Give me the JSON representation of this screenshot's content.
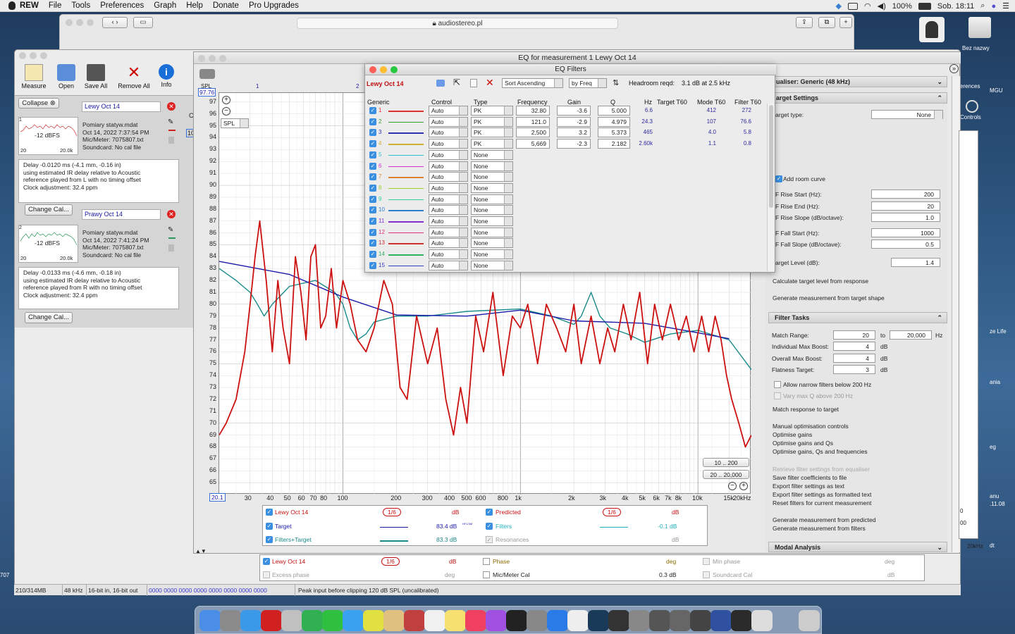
{
  "menubar": {
    "app": "REW",
    "items": [
      "File",
      "Tools",
      "Preferences",
      "Graph",
      "Help",
      "Donate",
      "Pro Upgrades"
    ],
    "battery": "100%",
    "clock": "Sob. 18:11"
  },
  "browser": {
    "url": "audiostereo.pl"
  },
  "desktop": {
    "labels": [
      "Bez nazwy",
      "erences",
      "MGU",
      "Controls",
      "ze Life",
      "ania",
      "eg",
      "anu",
      ".11.08",
      "dt",
      "707"
    ]
  },
  "toolbar": {
    "measure": "Measure",
    "open": "Open",
    "save_all": "Save All",
    "remove_all": "Remove All",
    "info": "Info"
  },
  "left": {
    "collapse": "Collapse",
    "m1": {
      "name": "Lewy Oct 14",
      "thumb_dbfs": "-12 dBFS",
      "thumb_min": "20",
      "thumb_max": "20.0k",
      "file": "Pomiary statyw.mdat",
      "date": "Oct 14, 2022 7:37:54 PM",
      "mic": "Mic/Meter: 7075807.txt",
      "sound": "Soundcard: No cal file",
      "delay1": "Delay -0.0120 ms (-4.1 mm, -0.16 in)",
      "delay2": "using estimated IR delay relative to Acoustic",
      "delay3": "reference played from  L with no timing offset",
      "delay4": "Clock adjustment: 32.4 ppm",
      "num": "1"
    },
    "m2": {
      "name": "Prawy Oct 14",
      "thumb_dbfs": "-12 dBFS",
      "thumb_min": "20",
      "thumb_max": "20.0k",
      "file": "Pomiary statyw.mdat",
      "date": "Oct 14, 2022 7:41:24 PM",
      "mic": "Mic/Meter: 7075807.txt",
      "sound": "Soundcard: No cal file",
      "delay1": "Delay -0.0133 ms (-4.6 mm, -0.18 in)",
      "delay2": "using estimated IR delay relative to Acoustic",
      "delay3": "reference played from  R with no timing offset",
      "delay4": "Clock adjustment: 32.4 ppm",
      "num": "2"
    },
    "change_cal": "Change Cal..."
  },
  "graph": {
    "window_title": "EQ for measurement 1 Lewy Oct 14",
    "y_unit": "SPL",
    "y_top": "97.76",
    "y_select": "SPL",
    "x_start": "20.1",
    "y_ticks": [
      "97",
      "96",
      "95",
      "94",
      "93",
      "92",
      "91",
      "90",
      "89",
      "88",
      "87",
      "86",
      "85",
      "84",
      "83",
      "82",
      "81",
      "80",
      "79",
      "78",
      "77",
      "76",
      "75",
      "74",
      "73",
      "72",
      "71",
      "70",
      "69",
      "68",
      "67",
      "66",
      "65"
    ],
    "x_ticks": [
      "30",
      "40",
      "50",
      "60",
      "70",
      "80",
      "100",
      "200",
      "300",
      "400",
      "500",
      "600",
      "800",
      "1k",
      "2k",
      "3k",
      "4k",
      "5k",
      "6k",
      "7k",
      "8k",
      "10k",
      "15k",
      "20kHz"
    ],
    "top_ticks": [
      "1",
      "2"
    ],
    "range1": "10 .. 200",
    "range2": "20 .. 20,000",
    "side_c": "C",
    "side_10": "10"
  },
  "legend": {
    "rows": [
      {
        "label": "Lewy Oct 14",
        "smooth": "1/6",
        "unit": "dB",
        "value": "",
        "color": "#cc1010"
      },
      {
        "label": "Target",
        "smooth": "",
        "unit": "",
        "value": "83.4 dB",
        "color": "#1a1aa8"
      },
      {
        "label": "Filters+Target",
        "smooth": "",
        "unit": "",
        "value": "83.3 dB",
        "color": "#1a8a8a"
      }
    ],
    "rows2": [
      {
        "label": "Predicted",
        "smooth": "1/6",
        "unit": "dB",
        "value": "",
        "color": "#cc1010"
      },
      {
        "label": "Filters",
        "smooth": "",
        "unit": "",
        "value": "-0.1 dB",
        "color": "#20b0c0"
      },
      {
        "label": "Resonances",
        "smooth": "",
        "unit": "dB",
        "value": "",
        "color": "#999"
      }
    ],
    "value_superscript": "HF1/3M"
  },
  "legend_bottom": {
    "name": "Lewy Oct 14",
    "smooth": "1/6",
    "db": "dB",
    "phase": "Phase",
    "deg": "deg",
    "min_phase": "Min phase",
    "deg2": "deg",
    "excess": "Excess phase",
    "deg3": "deg",
    "mic_cal": "Mic/Meter Cal",
    "mic_val": "0.3 dB",
    "sound_cal": "Soundcard Cal",
    "db2": "dB"
  },
  "eqf": {
    "title": "EQ Filters",
    "meas": "Lewy Oct 14",
    "sort": "Sort Ascending",
    "by": "by Freq",
    "headroom_label": "Headroom reqd:",
    "headroom_value": "3.1 dB at 2.5 kHz",
    "headers": {
      "generic": "Generic",
      "control": "Control",
      "type": "Type",
      "freq": "Frequency",
      "gain": "Gain",
      "q": "Q",
      "hz": "Hz",
      "target": "Target T60",
      "mode": "Mode T60",
      "filter": "Filter T60"
    },
    "rows": [
      {
        "n": "1",
        "color": "#e03030",
        "control": "Auto",
        "type": "PK",
        "freq": "32.80",
        "gain": "-3.6",
        "q": "5.000",
        "hz": "6.6",
        "mode": "412",
        "filt": "272"
      },
      {
        "n": "2",
        "color": "#30a030",
        "control": "Auto",
        "type": "PK",
        "freq": "121.0",
        "gain": "-2.9",
        "q": "4.979",
        "hz": "24.3",
        "mode": "107",
        "filt": "76.6"
      },
      {
        "n": "3",
        "color": "#3030b0",
        "control": "Auto",
        "type": "PK",
        "freq": "2,500",
        "gain": "3.2",
        "q": "5.373",
        "hz": "465",
        "mode": "4.0",
        "filt": "5.8"
      },
      {
        "n": "4",
        "color": "#d0b030",
        "control": "Auto",
        "type": "PK",
        "freq": "5,669",
        "gain": "-2.3",
        "q": "2.182",
        "hz": "2.60k",
        "mode": "1.1",
        "filt": "0.8"
      },
      {
        "n": "5",
        "color": "#30c0d0",
        "control": "Auto",
        "type": "None",
        "freq": "",
        "gain": "",
        "q": "",
        "hz": "",
        "mode": "",
        "filt": ""
      },
      {
        "n": "6",
        "color": "#d030d0",
        "control": "Auto",
        "type": "None",
        "freq": "",
        "gain": "",
        "q": "",
        "hz": "",
        "mode": "",
        "filt": ""
      },
      {
        "n": "7",
        "color": "#e08030",
        "control": "Auto",
        "type": "None",
        "freq": "",
        "gain": "",
        "q": "",
        "hz": "",
        "mode": "",
        "filt": ""
      },
      {
        "n": "8",
        "color": "#a0d030",
        "control": "Auto",
        "type": "None",
        "freq": "",
        "gain": "",
        "q": "",
        "hz": "",
        "mode": "",
        "filt": ""
      },
      {
        "n": "9",
        "color": "#30d0a0",
        "control": "Auto",
        "type": "None",
        "freq": "",
        "gain": "",
        "q": "",
        "hz": "",
        "mode": "",
        "filt": ""
      },
      {
        "n": "10",
        "color": "#3080d0",
        "control": "Auto",
        "type": "None",
        "freq": "",
        "gain": "",
        "q": "",
        "hz": "",
        "mode": "",
        "filt": ""
      },
      {
        "n": "11",
        "color": "#8030d0",
        "control": "Auto",
        "type": "None",
        "freq": "",
        "gain": "",
        "q": "",
        "hz": "",
        "mode": "",
        "filt": ""
      },
      {
        "n": "12",
        "color": "#e03080",
        "control": "Auto",
        "type": "None",
        "freq": "",
        "gain": "",
        "q": "",
        "hz": "",
        "mode": "",
        "filt": ""
      },
      {
        "n": "13",
        "color": "#d03030",
        "control": "Auto",
        "type": "None",
        "freq": "",
        "gain": "",
        "q": "",
        "hz": "",
        "mode": "",
        "filt": ""
      },
      {
        "n": "14",
        "color": "#30b060",
        "control": "Auto",
        "type": "None",
        "freq": "",
        "gain": "",
        "q": "",
        "hz": "",
        "mode": "",
        "filt": ""
      },
      {
        "n": "15",
        "color": "#3040c0",
        "control": "Auto",
        "type": "None",
        "freq": "",
        "gain": "",
        "q": "",
        "hz": "",
        "mode": "",
        "filt": ""
      }
    ]
  },
  "rightpanel": {
    "equaliser": "ualiser: Generic (48 kHz)",
    "target_settings": "arget Settings",
    "target_type": "arget type:",
    "target_type_val": "None",
    "add_room": "Add room curve",
    "rise_start": "F Rise Start (Hz):",
    "rise_start_v": "200",
    "rise_end": "F Rise End (Hz):",
    "rise_end_v": "20",
    "rise_slope": "F Rise Slope (dB/octave):",
    "rise_slope_v": "1.0",
    "fall_start": "F Fall Start (Hz):",
    "fall_start_v": "1000",
    "fall_slope": "F Fall Slope (dB/octave):",
    "fall_slope_v": "0.5",
    "target_level": "arget Level (dB):",
    "target_level_v": "1.4",
    "calc": "Calculate target level from response",
    "gen": "Generate measurement from target shape",
    "filter_tasks": "Filter Tasks",
    "match_range": "Match Range:",
    "mr1": "20",
    "to": "to",
    "mr2": "20,000",
    "hz": "Hz",
    "ind_boost": "Individual Max Boost:",
    "ind_v": "4",
    "db1": "dB",
    "ovr_boost": "Overall Max Boost:",
    "ovr_v": "4",
    "db2": "dB",
    "flat": "Flatness Target:",
    "flat_v": "3",
    "db3": "dB",
    "narrow": "Allow narrow filters below 200 Hz",
    "vary": "Vary max Q above 200 Hz",
    "match": "Match response to target",
    "manual": "Manual optimisation controls",
    "opt1": "Optimise gains",
    "opt2": "Optimise gains and Qs",
    "opt3": "Optimise gains, Qs and frequencies",
    "retrieve": "Retrieve filter settings from equaliser",
    "save": "Save filter coefficients to file",
    "export_text": "Export filter settings as text",
    "export_fmt": "Export filter settings as formatted text",
    "reset": "Reset filters for current measurement",
    "gen_pred": "Generate measurement from predicted",
    "gen_filt": "Generate measurement from filters",
    "modal": "Modal Analysis",
    "side_0": "0",
    "side_00": "00",
    "side_20k": "20kHz"
  },
  "status": {
    "mem": "210/314MB",
    "rate": "48 kHz",
    "bits": "16-bit in, 16-bit out",
    "meter": "0000 0000  0000 0000  0000 0000  0000 0000",
    "peak": "Peak input before clipping 120 dB SPL (uncalibrated)"
  },
  "chart_data": {
    "type": "line",
    "xlabel": "",
    "ylabel": "SPL",
    "xscale": "log",
    "xlim": [
      20.1,
      20000
    ],
    "ylim": [
      64,
      97.76
    ],
    "series": [
      {
        "name": "Lewy Oct 14",
        "color": "#cc1010",
        "x": [
          20.1,
          22,
          25,
          28,
          30,
          32,
          34,
          37,
          40,
          43,
          46,
          50,
          54,
          58,
          62,
          66,
          70,
          75,
          80,
          86,
          92,
          100,
          110,
          121,
          135,
          150,
          170,
          190,
          210,
          230,
          260,
          300,
          340,
          380,
          420,
          460,
          500,
          560,
          620,
          700,
          800,
          900,
          1000,
          1100,
          1250,
          1400,
          1600,
          1800,
          2000,
          2200,
          2500,
          2800,
          3100,
          3400,
          3800,
          4200,
          4700,
          5200,
          5700,
          6300,
          7000,
          7800,
          8600,
          9500,
          10500,
          11500,
          12500,
          13500,
          14500,
          15500,
          17000,
          18500,
          20000
        ],
        "y": [
          69,
          70,
          72,
          76,
          80,
          84,
          87,
          82,
          76,
          82,
          78,
          75,
          84,
          81,
          77,
          84,
          85,
          78,
          79,
          83,
          78,
          82,
          80,
          77,
          76,
          78,
          82,
          80,
          73,
          72,
          79,
          75,
          78,
          72,
          69,
          73,
          70,
          79,
          76,
          81,
          74,
          79,
          78,
          80,
          75,
          80,
          78,
          76,
          80,
          75,
          79,
          75,
          78,
          76,
          80,
          77,
          81,
          75,
          80,
          77,
          80,
          77,
          79,
          76,
          79,
          76,
          79,
          77,
          74,
          72,
          70,
          68,
          69
        ]
      },
      {
        "name": "Target",
        "color": "#1a1aa8",
        "x": [
          20.1,
          50,
          100,
          200,
          500,
          1000,
          2000,
          5000,
          10000,
          15000
        ],
        "y": [
          83.6,
          82.5,
          80.6,
          79.1,
          79.0,
          79.5,
          78.6,
          78.4,
          77.6,
          77.1
        ]
      },
      {
        "name": "Filters+Target",
        "color": "#1a8a8a",
        "x": [
          20.1,
          25,
          30,
          33,
          36,
          40,
          50,
          70,
          90,
          100,
          110,
          121,
          135,
          150,
          200,
          300,
          500,
          1000,
          1500,
          2000,
          2200,
          2500,
          2800,
          3200,
          4000,
          5000,
          7000,
          10000,
          15000,
          20000
        ],
        "y": [
          83,
          82,
          81,
          80,
          79,
          80,
          81.5,
          82,
          81,
          80,
          78,
          77,
          77.5,
          78.5,
          79,
          79,
          79.4,
          79.6,
          79,
          78.3,
          79,
          81,
          79,
          78,
          77.5,
          76.8,
          77.5,
          77.8,
          77,
          74.5
        ]
      }
    ]
  }
}
